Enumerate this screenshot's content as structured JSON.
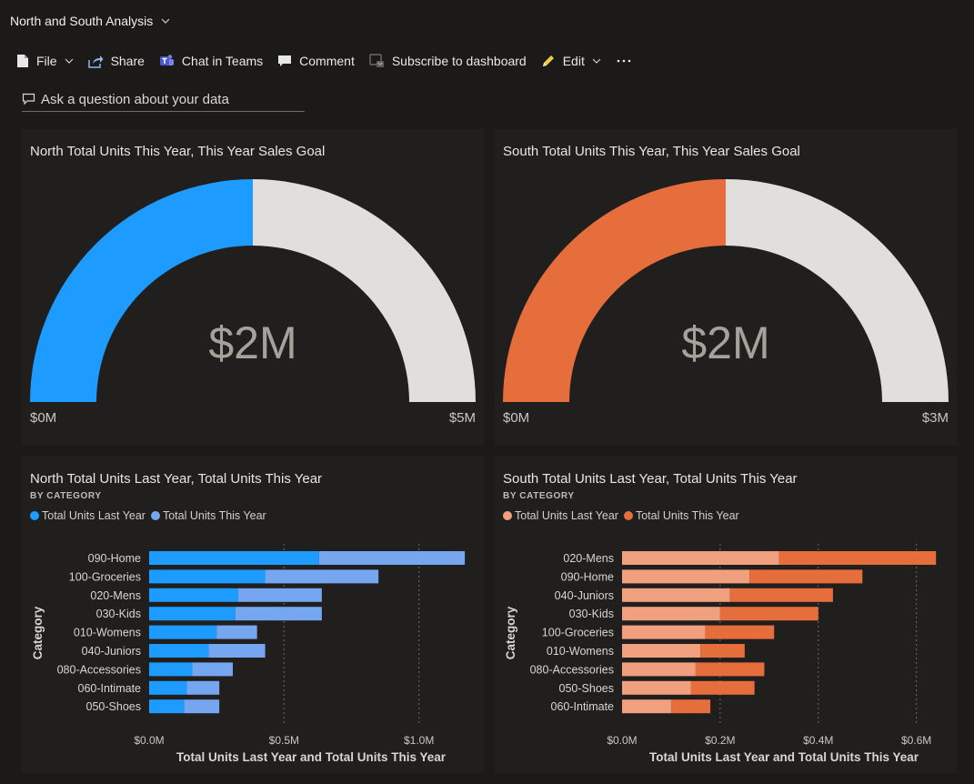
{
  "header": {
    "title": "North and South Analysis"
  },
  "toolbar": {
    "file": "File",
    "share": "Share",
    "chat": "Chat in Teams",
    "comment": "Comment",
    "subscribe": "Subscribe to dashboard",
    "edit": "Edit"
  },
  "qa": {
    "placeholder": "Ask a question about your data"
  },
  "gauges": [
    {
      "title": "North Total Units This Year, This Year Sales Goal",
      "value_label": "$2M",
      "min_label": "$0M",
      "max_label": "$5M",
      "value": 2.5,
      "max": 5,
      "fill_color": "#1e9bff",
      "rest_color": "#e1dfdb"
    },
    {
      "title": "South Total Units This Year, This Year Sales Goal",
      "value_label": "$2M",
      "min_label": "$0M",
      "max_label": "$3M",
      "value": 1.5,
      "max": 3,
      "fill_color": "#e66d3c",
      "rest_color": "#e1dfdb"
    }
  ],
  "chart_data": [
    {
      "type": "bar",
      "orientation": "horizontal",
      "stacked": true,
      "title": "North Total Units Last Year, Total Units This Year",
      "subtitle": "BY CATEGORY",
      "xlabel": "Total Units Last Year and Total Units This Year",
      "ylabel": "Category",
      "xlim": [
        0,
        1.2
      ],
      "xticks": [
        "$0.0M",
        "$0.5M",
        "$1.0M"
      ],
      "xtick_values": [
        0,
        0.5,
        1.0
      ],
      "categories": [
        "090-Home",
        "100-Groceries",
        "020-Mens",
        "030-Kids",
        "010-Womens",
        "040-Juniors",
        "080-Accessories",
        "060-Intimate",
        "050-Shoes"
      ],
      "series": [
        {
          "name": "Total Units Last Year",
          "color": "#1e9bff",
          "values": [
            0.63,
            0.43,
            0.33,
            0.32,
            0.25,
            0.22,
            0.16,
            0.14,
            0.13
          ]
        },
        {
          "name": "Total Units This Year",
          "color": "#76a6f0",
          "values": [
            0.54,
            0.42,
            0.31,
            0.32,
            0.15,
            0.21,
            0.15,
            0.12,
            0.13
          ]
        }
      ]
    },
    {
      "type": "bar",
      "orientation": "horizontal",
      "stacked": true,
      "title": "South Total Units Last Year, Total Units This Year",
      "subtitle": "BY CATEGORY",
      "xlabel": "Total Units Last Year and Total Units This Year",
      "ylabel": "Category",
      "xlim": [
        0,
        0.66
      ],
      "xticks": [
        "$0.0M",
        "$0.2M",
        "$0.4M",
        "$0.6M"
      ],
      "xtick_values": [
        0,
        0.2,
        0.4,
        0.6
      ],
      "categories": [
        "020-Mens",
        "090-Home",
        "040-Juniors",
        "030-Kids",
        "100-Groceries",
        "010-Womens",
        "080-Accessories",
        "050-Shoes",
        "060-Intimate"
      ],
      "series": [
        {
          "name": "Total Units Last Year",
          "color": "#f0a07e",
          "values": [
            0.32,
            0.26,
            0.22,
            0.2,
            0.17,
            0.16,
            0.15,
            0.14,
            0.1
          ]
        },
        {
          "name": "Total Units This Year",
          "color": "#e66d3c",
          "values": [
            0.32,
            0.23,
            0.21,
            0.2,
            0.14,
            0.09,
            0.14,
            0.13,
            0.08
          ]
        }
      ]
    }
  ]
}
